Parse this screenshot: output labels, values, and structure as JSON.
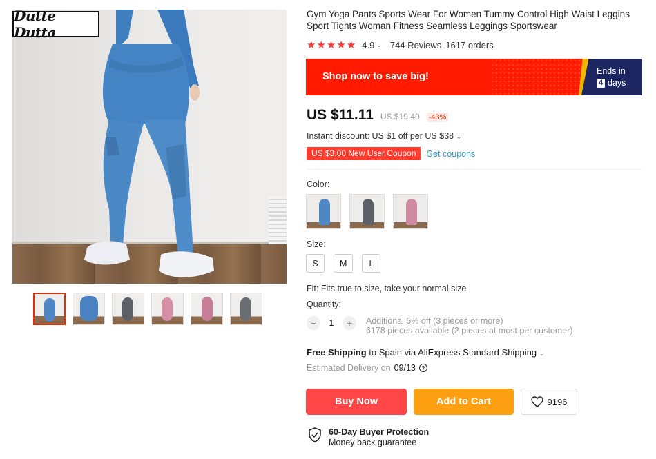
{
  "product": {
    "brand_logo": "Dutte Dutta",
    "title": "Gym Yoga Pants Sports Wear For Women Tummy Control High Waist Leggins Sport Tights Woman Fitness Seamless Leggings Sportswear"
  },
  "rating": {
    "stars": "★★★★★",
    "score": "4.9",
    "reviews": "744 Reviews",
    "orders": "1617 orders"
  },
  "promo": {
    "text": "Shop now to save big!",
    "ends_in": "Ends in",
    "days_value": "4",
    "days_label": "days",
    "colors": {
      "banner": "#ff1a00",
      "timer": "#1d2660",
      "accent": "#f5b400"
    }
  },
  "price": {
    "current": "US $11.11",
    "original": "US $19.49",
    "discount": "-43%"
  },
  "instant_discount": "Instant discount: US $1 off per US $38",
  "coupon": {
    "label": "US $3.00 New User Coupon",
    "link": "Get coupons"
  },
  "color": {
    "label": "Color:",
    "options": [
      {
        "name": "blue",
        "swatch": "#4f86c4"
      },
      {
        "name": "gray",
        "swatch": "#5d6066"
      },
      {
        "name": "pink",
        "swatch": "#cf8aa2"
      }
    ]
  },
  "size": {
    "label": "Size:",
    "options": [
      "S",
      "M",
      "L"
    ]
  },
  "fit": "Fit: Fits true to size, take your normal size",
  "quantity": {
    "label": "Quantity:",
    "minus": "−",
    "value": "1",
    "plus": "+",
    "additional": "Additional 5% off (3 pieces or more)",
    "available": "6178 pieces available (2 pieces at most per customer)"
  },
  "shipping": {
    "free": "Free Shipping",
    "rest": "to Spain via AliExpress Standard Shipping",
    "estimated": "Estimated Delivery on",
    "date": "09/13"
  },
  "actions": {
    "buy_now": "Buy Now",
    "add_to_cart": "Add to Cart",
    "wishlist_count": "9196",
    "colors": {
      "buy": "#ff4747",
      "cart": "#ffa012"
    }
  },
  "protection": {
    "title": "60-Day Buyer Protection",
    "subtitle": "Money back guarantee"
  },
  "gallery": {
    "thumbnails": [
      "blue-back",
      "blue-side",
      "gray-back",
      "pink-side",
      "pink-front",
      "gray-side"
    ]
  }
}
